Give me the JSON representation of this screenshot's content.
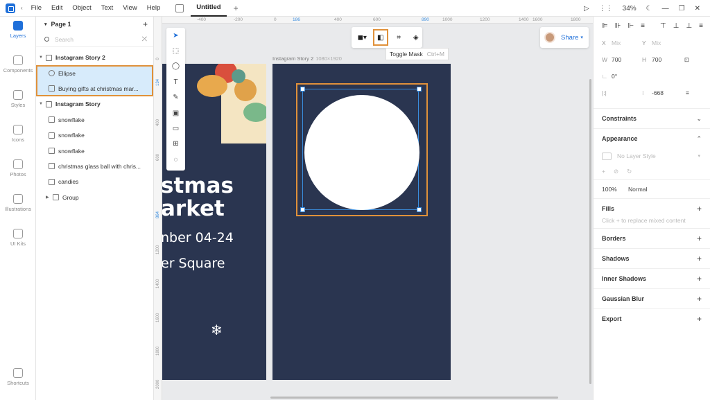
{
  "menu": [
    "File",
    "Edit",
    "Object",
    "Text",
    "View",
    "Help"
  ],
  "tab": "Untitled",
  "zoom": "34%",
  "rail": [
    {
      "label": "Layers",
      "name": "rail-layers"
    },
    {
      "label": "Components",
      "name": "rail-components"
    },
    {
      "label": "Styles",
      "name": "rail-styles"
    },
    {
      "label": "Icons",
      "name": "rail-icons"
    },
    {
      "label": "Photos",
      "name": "rail-photos"
    },
    {
      "label": "Illustrations",
      "name": "rail-illustrations"
    },
    {
      "label": "UI Kits",
      "name": "rail-ui-kits"
    }
  ],
  "rail_bottom": "Shortcuts",
  "layers": {
    "page": "Page 1",
    "search_placeholder": "Search",
    "items": [
      {
        "label": "Instagram Story 2",
        "kind": "frame"
      },
      {
        "label": "Ellipse",
        "kind": "ellipse"
      },
      {
        "label": "Buying gifts at christmas mar...",
        "kind": "image"
      },
      {
        "label": "Instagram Story",
        "kind": "frame"
      },
      {
        "label": "snowflake",
        "kind": "image"
      },
      {
        "label": "snowflake",
        "kind": "image"
      },
      {
        "label": "snowflake",
        "kind": "image"
      },
      {
        "label": "christmas glass ball with chris...",
        "kind": "image"
      },
      {
        "label": "candies",
        "kind": "image"
      },
      {
        "label": "Group",
        "kind": "folder"
      }
    ]
  },
  "ruler_top": [
    "-400",
    "-200",
    "0",
    "186",
    "400",
    "600",
    "890",
    "1000",
    "1200",
    "1400",
    "1600",
    "1800"
  ],
  "ruler_left": [
    "0",
    "134",
    "400",
    "600",
    "864",
    "1200",
    "1400",
    "1600",
    "1800",
    "2000"
  ],
  "tooltip": {
    "label": "Toggle Mask",
    "shortcut": "Ctrl+M"
  },
  "share": "Share",
  "story1": {
    "line1": "stmas",
    "line2": "arket",
    "line3": "nber 04-24",
    "line4": "er Square"
  },
  "story2": {
    "label": "Instagram Story 2",
    "dims": "1080×1920"
  },
  "props": {
    "x_label": "X",
    "x": "Mix",
    "y_label": "Y",
    "y": "Mix",
    "w_label": "W",
    "w": "700",
    "h_label": "H",
    "h": "700",
    "rotation": "0°",
    "spacing": "-668"
  },
  "sections": {
    "constraints": "Constraints",
    "appearance": "Appearance",
    "layer_style": "No Layer Style",
    "opacity": "100%",
    "blend": "Normal",
    "fills": "Fills",
    "fills_hint": "Click + to replace mixed content",
    "borders": "Borders",
    "shadows": "Shadows",
    "inner_shadows": "Inner Shadows",
    "gaussian_blur": "Gaussian Blur",
    "export": "Export"
  },
  "colors": {
    "accent": "#1e6fd9",
    "story_bg": "#2a3550",
    "highlight": "#e0913a"
  }
}
